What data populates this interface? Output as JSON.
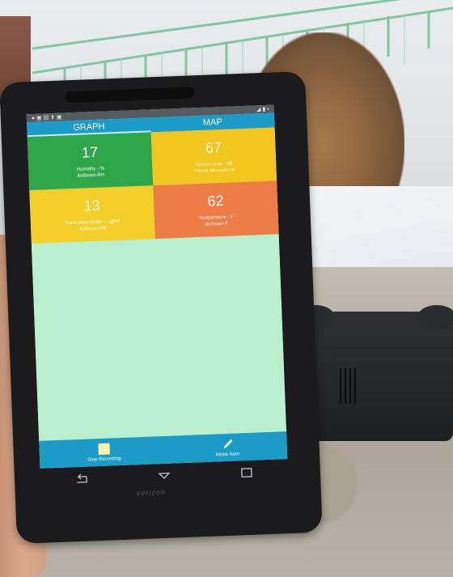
{
  "tabs": {
    "graph": "GRAPH",
    "map": "MAP"
  },
  "tiles": [
    {
      "value": "17",
      "label_line1": "Humidity - %",
      "label_line2": "AirBeam-RH",
      "color": "#2fa64a"
    },
    {
      "value": "67",
      "label_line1": "Sound Level - dB",
      "label_line2": "Phone Microphone",
      "color": "#f0c61f"
    },
    {
      "value": "13",
      "label_line1": "Particulate Matter - µg/m³",
      "label_line2": "AirBeam-PM",
      "color": "#f3cf2a"
    },
    {
      "value": "62",
      "label_line1": "Temperature - F",
      "label_line2": "AirBeam-F",
      "color": "#ee7c47"
    }
  ],
  "bottom_bar": {
    "stop_label": "Stop Recording",
    "note_label": "Make Note"
  },
  "device_brand": "verizon"
}
